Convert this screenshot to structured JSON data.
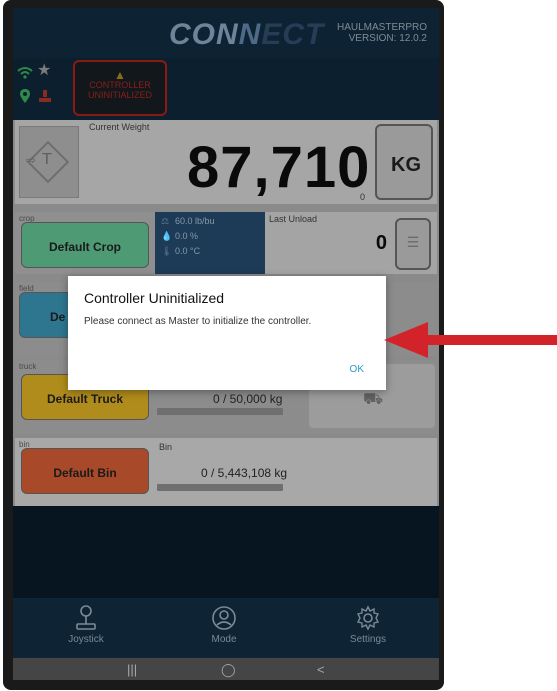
{
  "app": {
    "logo_left": "CON",
    "logo_mid": "N",
    "logo_right": "ECT",
    "version_line1": "HAULMASTERPRO",
    "version_line2": "VERSION: 12.0.2"
  },
  "status": {
    "controller_line1": "CONTROLLER",
    "controller_line2": "UNINITIALIZED"
  },
  "weight": {
    "label": "Current Weight",
    "value": "87,710",
    "sub_value": "0",
    "unit": "KG"
  },
  "crop": {
    "slot_label": "crop",
    "button": "Default Crop",
    "density": "60.0 lb/bu",
    "moisture": "0.0 %",
    "temperature": "0.0 °C"
  },
  "last_unload": {
    "label": "Last Unload",
    "value": "0"
  },
  "field": {
    "slot_label": "field",
    "button": "De"
  },
  "truck": {
    "slot_label": "truck",
    "button": "Default Truck",
    "progress": "0 / 50,000 kg",
    "fill_fraction": 0
  },
  "bin": {
    "slot_label": "bin",
    "button": "Default Bin",
    "header": "Bin",
    "progress": "0 / 5,443,108 kg",
    "fill_fraction": 0
  },
  "nav": {
    "joystick": "Joystick",
    "mode": "Mode",
    "settings": "Settings"
  },
  "dialog": {
    "title": "Controller Uninitialized",
    "message": "Please connect as Master to initialize the controller.",
    "ok": "OK"
  },
  "colors": {
    "appbar": "#0d2232",
    "dialog_ok": "#2a9bc2",
    "arrow": "#d3232a",
    "crop_button": "#4e9a75",
    "field_button": "#2e7690",
    "truck_button": "#b08c1c",
    "bin_button": "#a84a2a"
  },
  "icons": {
    "wifi": "wifi-icon",
    "star": "star-icon",
    "location": "location-pin-icon",
    "scale": "scale-icon",
    "warning": "warning-icon",
    "tare": "tare-icon",
    "list": "list-icon",
    "truck": "truck-icon",
    "joystick": "joystick-icon",
    "mode": "user-circle-icon",
    "settings": "gear-icon"
  }
}
